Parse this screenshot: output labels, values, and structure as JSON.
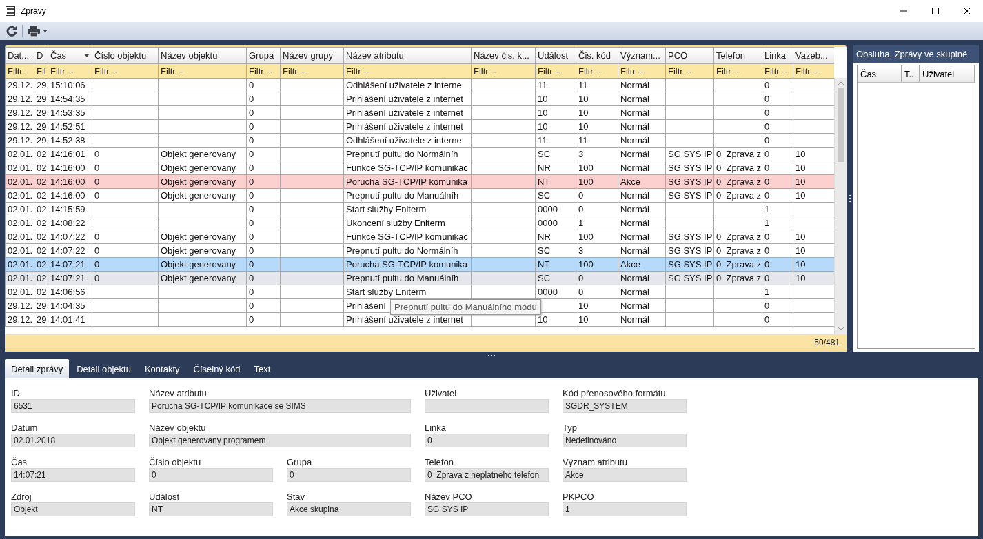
{
  "window": {
    "title": "Zprávy"
  },
  "grid": {
    "columns": [
      {
        "label": "Dat...",
        "filter": "Filtr -",
        "sorted": false
      },
      {
        "label": "D",
        "filter": "Fil",
        "sorted": false
      },
      {
        "label": "Čas",
        "filter": "Filtr --",
        "sorted": true
      },
      {
        "label": "Číslo objektu",
        "filter": "Filtr --",
        "sorted": false
      },
      {
        "label": "Název objektu",
        "filter": "Filtr --",
        "sorted": false
      },
      {
        "label": "Grupa",
        "filter": "Filtr --",
        "sorted": false
      },
      {
        "label": "Název grupy",
        "filter": "Filtr --",
        "sorted": false
      },
      {
        "label": "Název atributu",
        "filter": "Filtr --",
        "sorted": false
      },
      {
        "label": "Název čis. k...",
        "filter": "Filtr --",
        "sorted": false
      },
      {
        "label": "Událost",
        "filter": "Filtr --",
        "sorted": false
      },
      {
        "label": "Čis. kód",
        "filter": "Filtr --",
        "sorted": false
      },
      {
        "label": "Význam...",
        "filter": "Filtr --",
        "sorted": false
      },
      {
        "label": "PCO",
        "filter": "Filtr --",
        "sorted": false
      },
      {
        "label": "Telefon",
        "filter": "Filtr --",
        "sorted": false
      },
      {
        "label": "Linka",
        "filter": "Filtr --",
        "sorted": false
      },
      {
        "label": "Vazeb...",
        "filter": "Filtr --",
        "sorted": false
      }
    ],
    "rows": [
      {
        "selected": false,
        "alarm": false,
        "hover": false,
        "cells": [
          "29.12.",
          "29",
          "15:10:06",
          null,
          null,
          "0",
          null,
          "Odhlášení uživatele z interne",
          null,
          "11",
          "11",
          "Normál",
          null,
          null,
          "0",
          null
        ]
      },
      {
        "selected": false,
        "alarm": false,
        "hover": false,
        "cells": [
          "29.12.",
          "29",
          "14:54:35",
          null,
          null,
          "0",
          null,
          "Prihlášení uživatele z internet",
          null,
          "10",
          "10",
          "Normál",
          null,
          null,
          "0",
          null
        ]
      },
      {
        "selected": false,
        "alarm": false,
        "hover": false,
        "cells": [
          "29.12.",
          "29",
          "14:53:35",
          null,
          null,
          "0",
          null,
          "Prihlášení uživatele z internet",
          null,
          "10",
          "10",
          "Normál",
          null,
          null,
          "0",
          null
        ]
      },
      {
        "selected": false,
        "alarm": false,
        "hover": false,
        "cells": [
          "29.12.",
          "29",
          "14:52:51",
          null,
          null,
          "0",
          null,
          "Prihlášení uživatele z internet",
          null,
          "10",
          "10",
          "Normál",
          null,
          null,
          "0",
          null
        ]
      },
      {
        "selected": false,
        "alarm": false,
        "hover": false,
        "cells": [
          "29.12.",
          "29",
          "14:52:38",
          null,
          null,
          "0",
          null,
          "Odhlášení uživatele z interne",
          null,
          "11",
          "11",
          "Normál",
          null,
          null,
          "0",
          null
        ]
      },
      {
        "selected": false,
        "alarm": false,
        "hover": false,
        "cells": [
          "02.01.",
          "02",
          "14:16:01",
          "0",
          "Objekt generovany",
          "0",
          null,
          "Prepnutí pultu do Normálníh",
          null,
          "SC",
          "3",
          "Normál",
          "SG SYS IP",
          "0  Zprava z",
          "0",
          "10"
        ]
      },
      {
        "selected": false,
        "alarm": false,
        "hover": false,
        "cells": [
          "02.01.",
          "02",
          "14:16:00",
          "0",
          "Objekt generovany",
          "0",
          null,
          "Funkce SG-TCP/IP komunikac",
          null,
          "NR",
          "100",
          "Normál",
          "SG SYS IP",
          "0  Zprava z",
          "0",
          "10"
        ]
      },
      {
        "selected": false,
        "alarm": true,
        "hover": false,
        "cells": [
          "02.01.",
          "02",
          "14:16:00",
          "0",
          "Objekt generovany",
          "0",
          null,
          "Porucha SG-TCP/IP komunika",
          null,
          "NT",
          "100",
          "Akce",
          "SG SYS IP",
          "0  Zprava z",
          "0",
          "10"
        ]
      },
      {
        "selected": false,
        "alarm": false,
        "hover": false,
        "cells": [
          "02.01.",
          "02",
          "14:16:00",
          "0",
          "Objekt generovany",
          "0",
          null,
          "Prepnutí pultu do Manuálníh",
          null,
          "SC",
          "0",
          "Normál",
          "SG SYS IP",
          "0  Zprava z",
          "0",
          "10"
        ]
      },
      {
        "selected": false,
        "alarm": false,
        "hover": false,
        "cells": [
          "02.01.",
          "02",
          "14:15:59",
          null,
          null,
          "0",
          null,
          "Start služby Eniterm",
          null,
          "0000",
          "0",
          "Normál",
          null,
          null,
          "1",
          null
        ]
      },
      {
        "selected": false,
        "alarm": false,
        "hover": false,
        "cells": [
          "02.01.",
          "02",
          "14:08:22",
          null,
          null,
          "0",
          null,
          "Ukoncení služby Eniterm",
          null,
          "0000",
          "1",
          "Normál",
          null,
          null,
          "1",
          null
        ]
      },
      {
        "selected": false,
        "alarm": false,
        "hover": false,
        "cells": [
          "02.01.",
          "02",
          "14:07:22",
          "0",
          "Objekt generovany",
          "0",
          null,
          "Funkce SG-TCP/IP komunikac",
          null,
          "NR",
          "100",
          "Normál",
          "SG SYS IP",
          "0  Zprava z",
          "0",
          "10"
        ]
      },
      {
        "selected": false,
        "alarm": false,
        "hover": false,
        "cells": [
          "02.01.",
          "02",
          "14:07:22",
          "0",
          "Objekt generovany",
          "0",
          null,
          "Prepnutí pultu do Normálníh",
          null,
          "SC",
          "3",
          "Normál",
          "SG SYS IP",
          "0  Zprava z",
          "0",
          "10"
        ]
      },
      {
        "selected": true,
        "alarm": false,
        "hover": false,
        "cells": [
          "02.01.",
          "02",
          "14:07:21",
          "0",
          "Objekt generovany",
          "0",
          null,
          "Porucha SG-TCP/IP komunika",
          null,
          "NT",
          "100",
          "Akce",
          "SG SYS IP",
          "0  Zprava z",
          "0",
          "10"
        ]
      },
      {
        "selected": false,
        "alarm": false,
        "hover": true,
        "cells": [
          "02.01.",
          "02",
          "14:07:21",
          "0",
          "Objekt generovany",
          "0",
          null,
          "Prepnutí pultu do Manuálníh",
          null,
          "SC",
          "0",
          "Normál",
          "SG SYS IP",
          "0  Zprava z",
          "0",
          "10"
        ]
      },
      {
        "selected": false,
        "alarm": false,
        "hover": false,
        "cells": [
          "02.01.",
          "02",
          "14:06:56",
          null,
          null,
          "0",
          null,
          "Start služby Eniterm",
          null,
          "0000",
          "0",
          "Normál",
          null,
          null,
          "1",
          null
        ]
      },
      {
        "selected": false,
        "alarm": false,
        "hover": false,
        "cells": [
          "29.12.",
          "29",
          "14:04:35",
          null,
          null,
          "0",
          null,
          "Prihlášení",
          null,
          null,
          "10",
          "Normál",
          null,
          null,
          "0",
          null
        ]
      },
      {
        "selected": false,
        "alarm": false,
        "hover": false,
        "cells": [
          "29.12.",
          "29",
          "14:01:41",
          null,
          null,
          "0",
          null,
          "Prihlášení uživatele z internet",
          null,
          "10",
          "10",
          "Normál",
          null,
          null,
          "0",
          null
        ]
      }
    ],
    "tooltip": "Prepnutí pultu do Manuálního módu",
    "count": "50/481"
  },
  "side_panel": {
    "title": "Obsluha, Zprávy ve skupině",
    "columns": [
      "Čas",
      "T...",
      "Uživatel"
    ]
  },
  "tabs": [
    {
      "label": "Detail zprávy",
      "selected": true
    },
    {
      "label": "Detail objektu",
      "selected": false
    },
    {
      "label": "Kontakty",
      "selected": false
    },
    {
      "label": "Číselný kód",
      "selected": false
    },
    {
      "label": "Text",
      "selected": false
    }
  ],
  "detail": {
    "rows": [
      {
        "fields": [
          {
            "label": "ID",
            "value": "6531"
          },
          {
            "label": "Název atributu",
            "value": "Porucha SG-TCP/IP komunikace se SIMS"
          },
          {
            "label": "Uživatel"
          },
          {
            "label": "Kód přenosového formátu",
            "value": "SGDR_SYSTEM"
          }
        ]
      },
      {
        "fields": [
          {
            "label": "Datum",
            "value": "02.01.2018"
          },
          {
            "label": "Název objektu",
            "value": "Objekt generovany programem"
          },
          {
            "label": "Linka",
            "value": "0"
          },
          {
            "label": "Typ",
            "value": "Nedefinováno"
          }
        ]
      },
      {
        "fields": [
          {
            "label": "Čas",
            "value": "14:07:21"
          },
          {
            "label": "Číslo objektu",
            "value": "0"
          },
          {
            "label": "Grupa",
            "value": "0"
          },
          {
            "label": "Telefon",
            "value": "0  Zprava z neplatneho telefon"
          },
          {
            "label": "Význam atributu",
            "value": "Akce"
          }
        ]
      },
      {
        "fields": [
          {
            "label": "Zdroj",
            "value": "Objekt"
          },
          {
            "label": "Událost",
            "value": "NT"
          },
          {
            "label": "Stav",
            "value": "Akce skupina"
          },
          {
            "label": "Název PCO",
            "value": "SG SYS IP"
          },
          {
            "label": "PKPCO",
            "value": "1"
          }
        ]
      }
    ]
  }
}
